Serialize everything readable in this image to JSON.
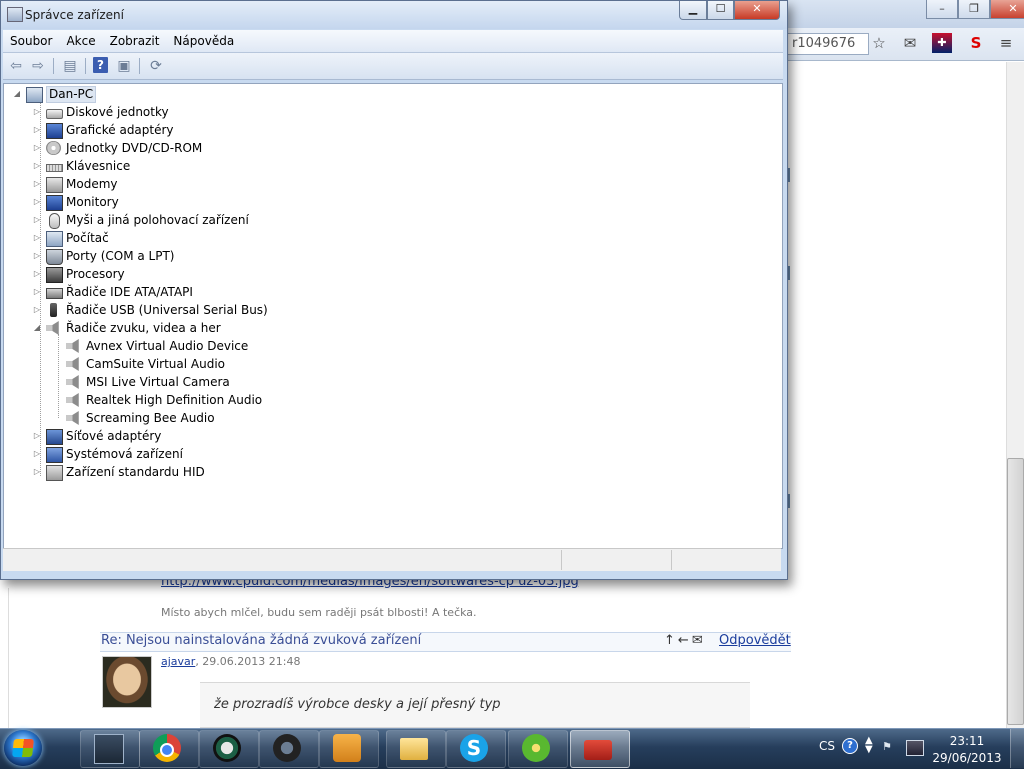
{
  "browser": {
    "address_fragment": "r1049676",
    "page": {
      "link_url": "http://www.cpuid.com/medias/images/en/softwares-cp uz-03.jpg",
      "signature": "Místo abych mlčel, budu sem raději psát blbosti! A tečka.",
      "reply_title": "Re: Nejsou nainstalována žádná zvuková zařízení",
      "reply_link": "Odpovědět",
      "author_name": "ajavar",
      "author_date": ", 29.06.2013 21:48",
      "quote": "že prozradíš výrobce desky a její přesný typ"
    }
  },
  "device_manager": {
    "title": "Správce zařízení",
    "menu": [
      "Soubor",
      "Akce",
      "Zobrazit",
      "Nápověda"
    ],
    "root": "Dan-PC",
    "categories": [
      "Diskové jednotky",
      "Grafické adaptéry",
      "Jednotky DVD/CD-ROM",
      "Klávesnice",
      "Modemy",
      "Monitory",
      "Myši a jiná polohovací zařízení",
      "Počítač",
      "Porty (COM a LPT)",
      "Procesory",
      "Řadiče IDE ATA/ATAPI",
      "Řadiče USB (Universal Serial Bus)",
      "Řadiče zvuku, videa a her",
      "Síťové adaptéry",
      "Systémová zařízení",
      "Zařízení standardu HID"
    ],
    "sound_devices": [
      "Avnex Virtual Audio Device",
      "CamSuite Virtual Audio",
      "MSI Live Virtual Camera",
      "Realtek High Definition Audio",
      "Screaming Bee Audio"
    ]
  },
  "taskbar": {
    "language": "CS",
    "time": "23:11",
    "date": "29/06/2013",
    "help_glyph": "?",
    "skype_glyph": "S"
  },
  "colors": {
    "link": "#1a3c9c",
    "window_frame": "#c8daf0",
    "close_red": "#c73a26"
  }
}
